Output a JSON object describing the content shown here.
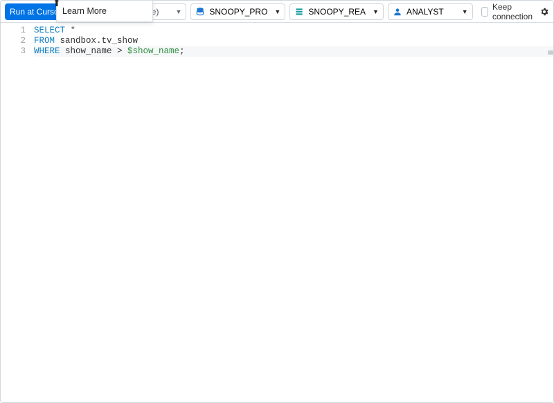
{
  "toolbar": {
    "run_button": "Run at Curso",
    "learn_more": "Learn More",
    "partial_dropdown_tail": "te)",
    "db1": "SNOOPY_PRO",
    "db2": "SNOOPY_REA",
    "role": "ANALYST",
    "keep_connection": "Keep connection"
  },
  "editor": {
    "lines": [
      {
        "n": "1",
        "segments": [
          {
            "cls": "kw",
            "t": "SELECT"
          },
          {
            "cls": "star",
            "t": " *"
          }
        ]
      },
      {
        "n": "2",
        "segments": [
          {
            "cls": "kw",
            "t": "FROM"
          },
          {
            "cls": "ident",
            "t": " sandbox.tv_show"
          }
        ]
      },
      {
        "n": "3",
        "current": true,
        "segments": [
          {
            "cls": "kw",
            "t": "WHERE"
          },
          {
            "cls": "ident",
            "t": " show_name > "
          },
          {
            "cls": "var",
            "t": "$show_name"
          },
          {
            "cls": "ident",
            "t": ";"
          }
        ]
      }
    ]
  }
}
